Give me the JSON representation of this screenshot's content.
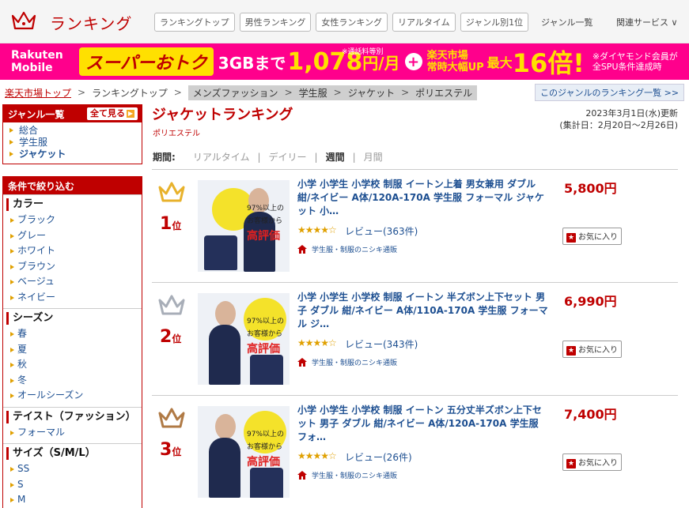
{
  "header": {
    "title": "ランキング",
    "tabs": [
      "ランキングトップ",
      "男性ランキング",
      "女性ランキング",
      "リアルタイム",
      "ジャンル別1位"
    ],
    "genre_list": "ジャンル一覧",
    "related": "関連サービス ∨"
  },
  "banner": {
    "brand_line1": "Rakuten",
    "brand_line2": "Mobile",
    "super": "スーパーおトク",
    "gb": "3GBまで",
    "price": "1,078",
    "price_unit": "円/月",
    "note1": "※通話料等別",
    "ichiba_line1": "楽天市場",
    "ichiba_line2": "常時大幅UP",
    "max": "最大",
    "multiplier": "16倍!",
    "note2_line1": "※ダイヤモンド会員が",
    "note2_line2": "全SPU条件達成時"
  },
  "breadcrumb": {
    "home": "楽天市場トップ",
    "top": "ランキングトップ",
    "path": [
      "メンズファッション",
      "学生服",
      "ジャケット",
      "ポリエステル"
    ],
    "separator": ">",
    "genre_ranking_link": "このジャンルのランキング一覧 >>"
  },
  "sidebar": {
    "genre_heading": "ジャンル一覧",
    "see_all": "全て見る",
    "genres": [
      "総合",
      "学生服",
      "ジャケット"
    ],
    "filter_heading": "条件で絞り込む",
    "sections": [
      {
        "title": "カラー",
        "items": [
          "ブラック",
          "グレー",
          "ホワイト",
          "ブラウン",
          "ベージュ",
          "ネイビー"
        ]
      },
      {
        "title": "シーズン",
        "items": [
          "春",
          "夏",
          "秋",
          "冬",
          "オールシーズン"
        ]
      },
      {
        "title": "テイスト（ファッション）",
        "items": [
          "フォーマル"
        ]
      },
      {
        "title": "サイズ（S/M/L）",
        "items": [
          "SS",
          "S",
          "M"
        ]
      }
    ]
  },
  "main": {
    "title": "ジャケットランキング",
    "subtitle": "ポリエステル",
    "update_line1": "2023年3月1日(水)更新",
    "update_line2": "(集計日：2月20日〜2月26日)",
    "period_label": "期間:",
    "periods": [
      "リアルタイム",
      "デイリー",
      "週間",
      "月間"
    ],
    "period_separator": "|"
  },
  "items": [
    {
      "rank": "1",
      "rank_suffix": "位",
      "title": "小学 小学生 小学校 制服 イートン上着 男女兼用 ダブル 紺/ネイビー A体/120A-170A 学生服 フォーマル ジャケット 小…",
      "rating": 4.5,
      "stars": "★★★★☆",
      "reviews": "レビュー(363件)",
      "shop": "学生服・制服のニシキ通販",
      "price": "5,800円",
      "fav": "お気に入り",
      "crown_color": "#e8b22c",
      "thumb_line1": "97%以上の",
      "thumb_line2": "お客様から",
      "thumb_line3": "高評価"
    },
    {
      "rank": "2",
      "rank_suffix": "位",
      "title": "小学 小学生 小学校 制服 イートン 半ズボン上下セット 男子 ダブル 紺/ネイビー A体/110A-170A 学生服 フォーマル ジ…",
      "rating": 4.5,
      "stars": "★★★★☆",
      "reviews": "レビュー(343件)",
      "shop": "学生服・制服のニシキ通販",
      "price": "6,990円",
      "fav": "お気に入り",
      "crown_color": "#a8aeb8",
      "thumb_line1": "97%以上の",
      "thumb_line2": "お客様から",
      "thumb_line3": "高評価"
    },
    {
      "rank": "3",
      "rank_suffix": "位",
      "title": "小学 小学生 小学校 制服 イートン 五分丈半ズボン上下セット 男子 ダブル 紺/ネイビー A体/120A-170A 学生服 フォ…",
      "rating": 4.5,
      "stars": "★★★★☆",
      "reviews": "レビュー(26件)",
      "shop": "学生服・制服のニシキ通販",
      "price": "7,400円",
      "fav": "お気に入り",
      "crown_color": "#b07a45",
      "thumb_line1": "97%以上の",
      "thumb_line2": "お客様から",
      "thumb_line3": "高評価"
    }
  ],
  "colors": {
    "accent": "#bf0000",
    "banner": "#ff008c",
    "link": "#1d4f91"
  }
}
